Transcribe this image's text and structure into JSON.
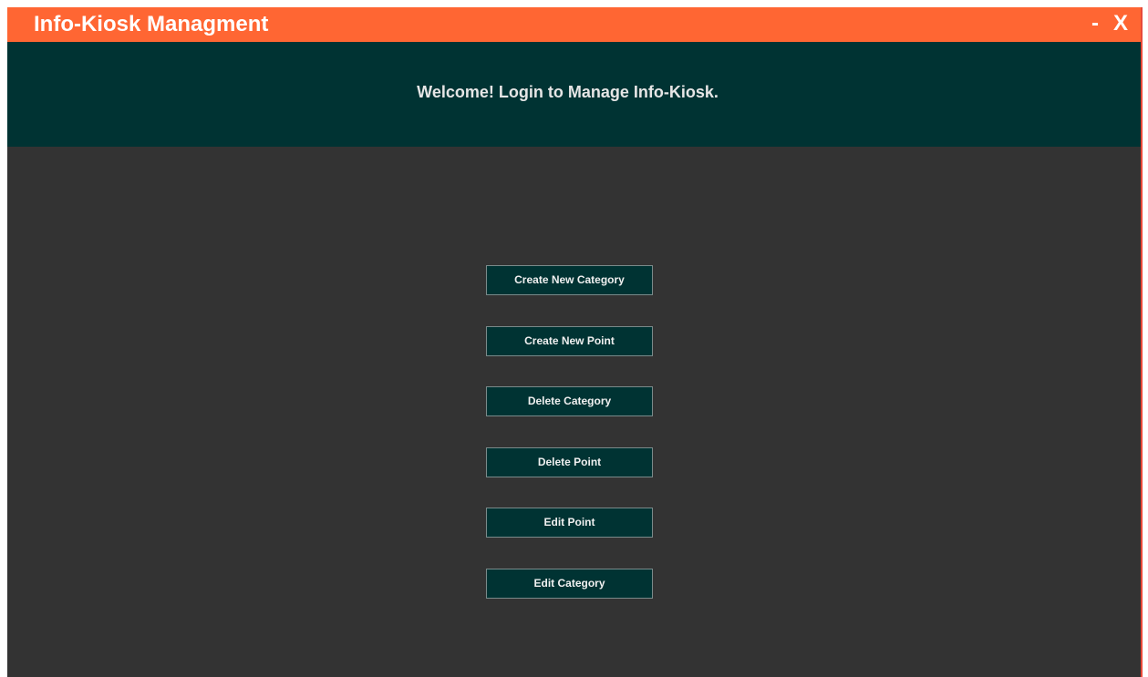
{
  "window": {
    "title": "Info-Kiosk Managment",
    "minimize_label": "-",
    "close_label": "X"
  },
  "header": {
    "welcome_text": "Welcome! Login to Manage Info-Kiosk."
  },
  "menu": {
    "buttons": [
      {
        "label": "Create New Category"
      },
      {
        "label": "Create New Point"
      },
      {
        "label": "Delete Category"
      },
      {
        "label": "Delete Point"
      },
      {
        "label": "Edit Point"
      },
      {
        "label": "Edit Category"
      }
    ]
  },
  "colors": {
    "titlebar": "#ff6633",
    "header": "#003333",
    "body": "#333333",
    "button": "#003333",
    "button_border": "#7a8a8a"
  }
}
